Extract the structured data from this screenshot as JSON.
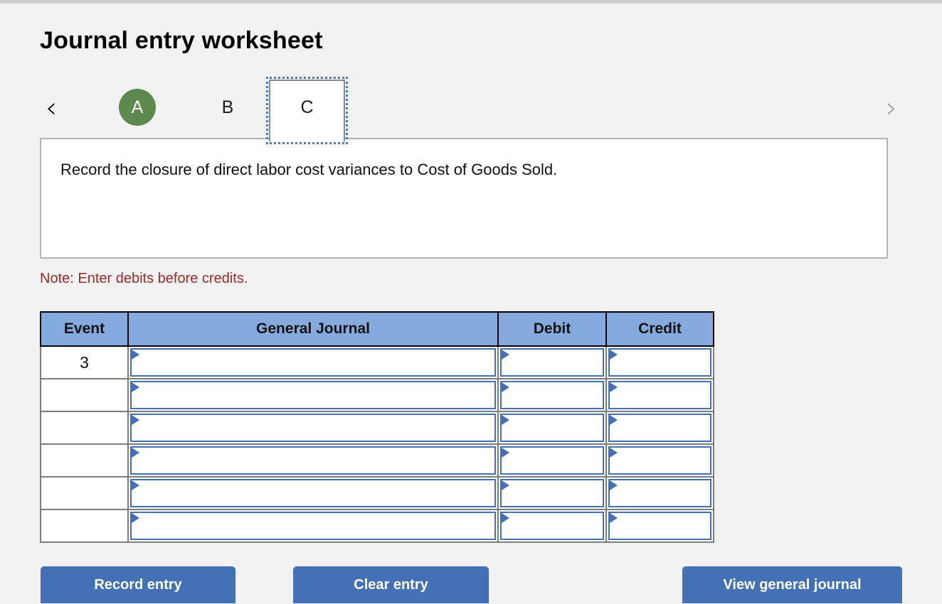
{
  "page": {
    "title": "Journal entry worksheet",
    "note": "Note: Enter debits before credits."
  },
  "tabs": {
    "prev_icon": "‹",
    "next_icon": "›",
    "items": [
      {
        "label": "A",
        "state": "completed"
      },
      {
        "label": "B",
        "state": "available"
      },
      {
        "label": "C",
        "state": "selected"
      }
    ]
  },
  "prompt": {
    "text": "Record the closure of direct labor cost variances to Cost of Goods Sold."
  },
  "table": {
    "headers": [
      "Event",
      "General Journal",
      "Debit",
      "Credit"
    ],
    "rows": [
      {
        "event": "3",
        "general_journal": "",
        "debit": "",
        "credit": ""
      },
      {
        "event": "",
        "general_journal": "",
        "debit": "",
        "credit": ""
      },
      {
        "event": "",
        "general_journal": "",
        "debit": "",
        "credit": ""
      },
      {
        "event": "",
        "general_journal": "",
        "debit": "",
        "credit": ""
      },
      {
        "event": "",
        "general_journal": "",
        "debit": "",
        "credit": ""
      },
      {
        "event": "",
        "general_journal": "",
        "debit": "",
        "credit": ""
      }
    ]
  },
  "buttons": {
    "record": "Record entry",
    "clear": "Clear entry",
    "view": "View general journal"
  },
  "colors": {
    "background": "#f2f2f2",
    "header_blue": "#85aade",
    "cell_border_blue": "#4471b5",
    "button_blue": "#4471b5",
    "tab_green": "#5c8a4c",
    "note_red": "#9c2b2b",
    "focus_outline": "#4a7ebb"
  }
}
